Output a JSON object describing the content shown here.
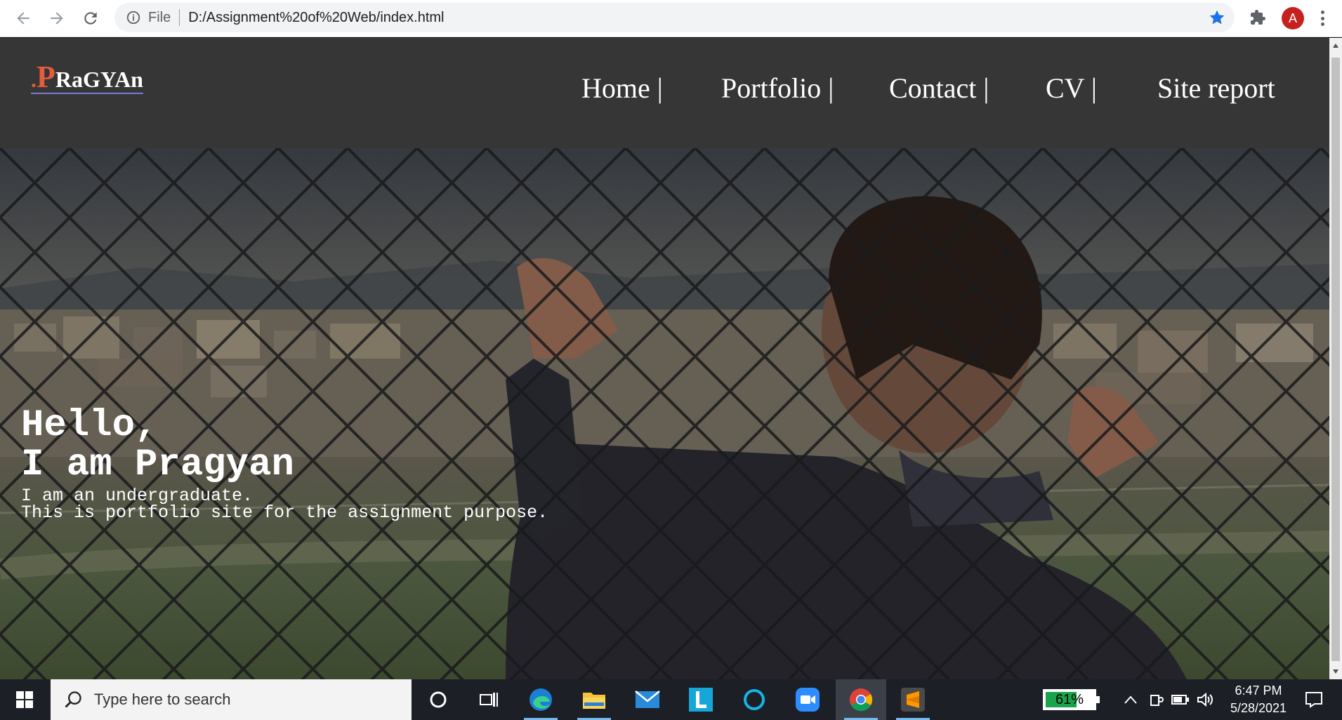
{
  "browser": {
    "info_label": "File",
    "url": "D:/Assignment%20of%20Web/index.html",
    "profile_initial": "A"
  },
  "site": {
    "logo": {
      "dot": ".",
      "first": "P",
      "rest": "RaGYAn"
    },
    "menu": [
      {
        "label": "Home |"
      },
      {
        "label": "Portfolio |"
      },
      {
        "label": "Contact |"
      },
      {
        "label": "CV |"
      },
      {
        "label": "Site report"
      }
    ],
    "hero": {
      "title": "Hello,\nI am Pragyan",
      "subtitle": "I am an undergraduate.\nThis is portfolio site for the assignment purpose."
    }
  },
  "taskbar": {
    "search_placeholder": "Type here to search",
    "battery_percent": "61%",
    "time": "6:47 PM",
    "date": "5/28/2021"
  },
  "colors": {
    "header_bg": "#363636",
    "logo_accent": "#e45c3e",
    "taskbar_bg": "#1c1f26"
  }
}
